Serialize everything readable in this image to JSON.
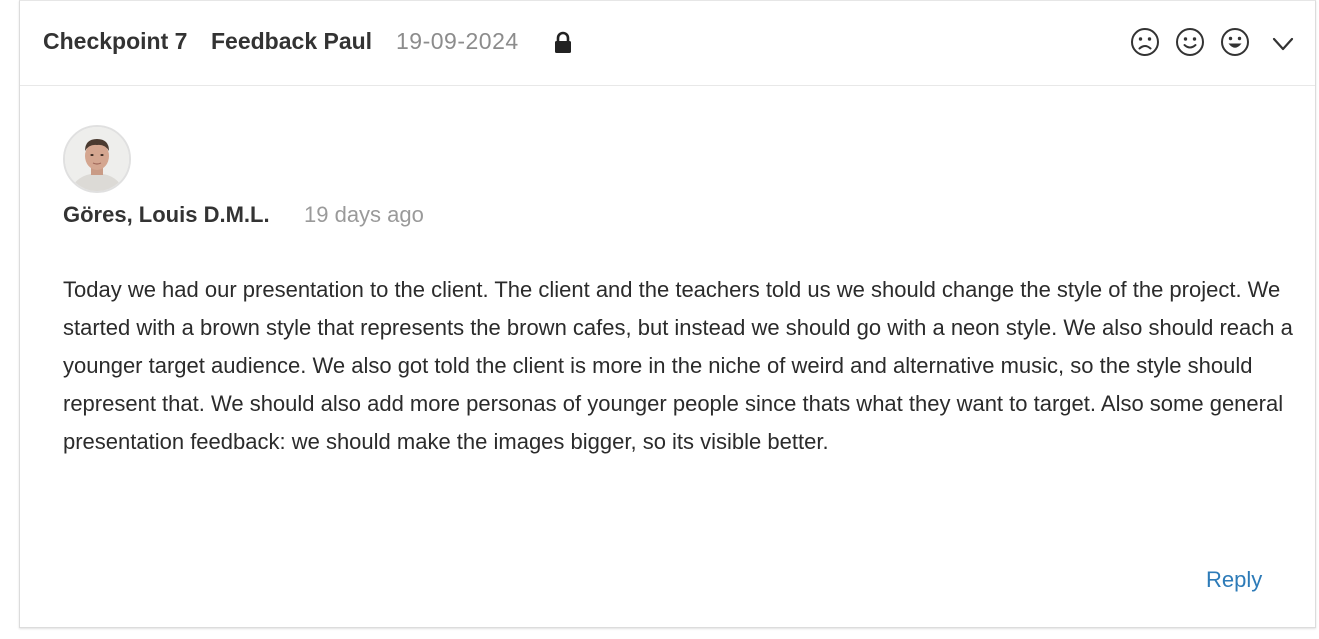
{
  "header": {
    "checkpoint": "Checkpoint 7",
    "title": "Feedback Paul",
    "date": "19-09-2024",
    "lock_icon": "lock-icon",
    "reactions": [
      "frown-icon",
      "smile-icon",
      "grin-icon"
    ],
    "collapse_icon": "chevron-down-icon"
  },
  "comment": {
    "author": "Göres, Louis D.M.L.",
    "time": "19 days ago",
    "text": "Today we had our presentation to the client. The client and the teachers told us we should change the style of the project. We started with a brown style that represents the brown cafes, but instead we should go with a neon style. We also should reach a younger target audience. We also got told the client is more in the niche of weird and alternative music, so the style should represent that. We should also add more personas of younger people since thats what they want to target. Also some general presentation feedback: we should make the images bigger, so its visible better."
  },
  "actions": {
    "reply_label": "Reply"
  },
  "colors": {
    "link": "#2d7bb8",
    "muted": "#8c8c8c",
    "text": "#333333"
  }
}
